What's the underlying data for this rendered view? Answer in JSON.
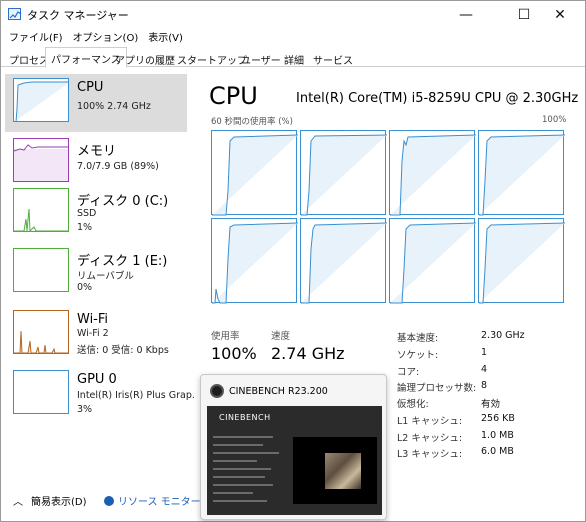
{
  "window": {
    "title": "タスク マネージャー",
    "minimize_glyph": "—",
    "maximize_glyph": "☐",
    "close_glyph": "✕"
  },
  "menu": [
    "ファイル(F)",
    "オプション(O)",
    "表示(V)"
  ],
  "tabs": [
    "プロセス",
    "パフォーマンス",
    "アプリの履歴",
    "スタートアップ",
    "ユーザー",
    "詳細",
    "サービス"
  ],
  "active_tab": "パフォーマンス",
  "left_items": [
    {
      "title": "CPU",
      "line1": "100%  2.74 GHz",
      "line2": "",
      "selected": true,
      "graph_color": "#3a8fd1"
    },
    {
      "title": "メモリ",
      "line1": "7.0/7.9 GB (89%)",
      "line2": "",
      "selected": false,
      "graph_color": "#9b3fb5"
    },
    {
      "title": "ディスク 0 (C:)",
      "line1": "SSD",
      "line2": "1%",
      "selected": false,
      "graph_color": "#4fae3a"
    },
    {
      "title": "ディスク 1 (E:)",
      "line1": "リムーバブル",
      "line2": "0%",
      "selected": false,
      "graph_color": "#4fae3a"
    },
    {
      "title": "Wi-Fi",
      "line1": "Wi-Fi 2",
      "line2": "送信: 0  受信: 0 Kbps",
      "selected": false,
      "graph_color": "#b5651d"
    },
    {
      "title": "GPU 0",
      "line1": "Intel(R) Iris(R) Plus Grap.",
      "line2": "3%",
      "selected": false,
      "graph_color": "#3a8fd1"
    }
  ],
  "main": {
    "title": "CPU",
    "model": "Intel(R) Core(TM) i5-8259U CPU @ 2.30GHz",
    "graph_caption": "60 秒間の使用率 (%)",
    "graph_max": "100%",
    "utilization_label": "使用率",
    "utilization_value": "100%",
    "speed_label": "速度",
    "speed_value": "2.74 GHz",
    "specs": [
      {
        "label": "基本速度:",
        "value": "2.30 GHz"
      },
      {
        "label": "ソケット:",
        "value": "1"
      },
      {
        "label": "コア:",
        "value": "4"
      },
      {
        "label": "論理プロセッサ数:",
        "value": "8"
      },
      {
        "label": "仮想化:",
        "value": "有効"
      },
      {
        "label": "L1 キャッシュ:",
        "value": "256 KB"
      },
      {
        "label": "L2 キャッシュ:",
        "value": "1.0 MB"
      },
      {
        "label": "L3 キャッシュ:",
        "value": "6.0 MB"
      }
    ]
  },
  "footer": {
    "fewer_details": "簡易表示(D)",
    "resource_monitor": "リソース モニターを開"
  },
  "popup": {
    "title": "CINEBENCH R23.200",
    "logo": "CINEBENCH"
  },
  "colors": {
    "cpu_line": "#3a8fd1",
    "cpu_fill": "#e8f2fb",
    "selected_bg": "#dcdcdc"
  }
}
